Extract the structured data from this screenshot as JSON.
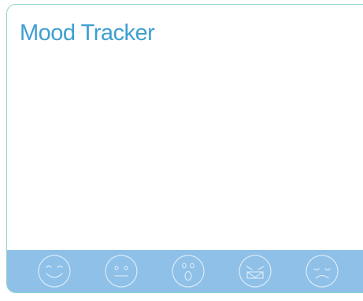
{
  "app": {
    "title": "Mood Tracker"
  },
  "moods": [
    {
      "name": "happy",
      "icon": "happy-face-icon"
    },
    {
      "name": "neutral",
      "icon": "neutral-face-icon"
    },
    {
      "name": "surprised",
      "icon": "surprised-face-icon"
    },
    {
      "name": "angry",
      "icon": "angry-face-icon"
    },
    {
      "name": "sad",
      "icon": "sad-face-icon"
    }
  ],
  "colors": {
    "title": "#3d9fd1",
    "border": "#8fd3cc",
    "bar": "#8ec0e8",
    "icon_stroke": "#d6e8f6"
  }
}
